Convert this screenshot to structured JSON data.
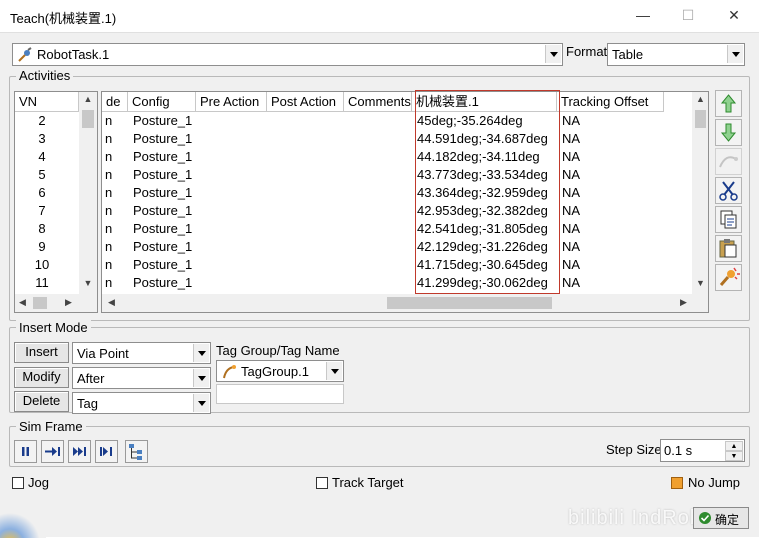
{
  "window": {
    "title": "Teach(机械装置.1)",
    "minimize_glyph": "—",
    "maximize_glyph": "☐",
    "close_glyph": "✕"
  },
  "task_combo": {
    "value": "RobotTask.1",
    "icon": "robot-task-icon"
  },
  "format": {
    "label": "Format",
    "value": "Table"
  },
  "activities": {
    "legend": "Activities",
    "vn_header": "VN",
    "vn_values": [
      "2",
      "3",
      "4",
      "5",
      "6",
      "7",
      "8",
      "9",
      "10",
      "11"
    ],
    "columns": [
      "de",
      "Config",
      "Pre Action",
      "Post Action",
      "Comments",
      "机械装置.1",
      "Tracking Offset"
    ],
    "rows": [
      {
        "de": "n",
        "config": "Posture_1",
        "pre": "",
        "post": "",
        "comments": "",
        "joint": "45deg;-35.264deg",
        "offset": "NA"
      },
      {
        "de": "n",
        "config": "Posture_1",
        "pre": "",
        "post": "",
        "comments": "",
        "joint": "44.591deg;-34.687deg",
        "offset": "NA"
      },
      {
        "de": "n",
        "config": "Posture_1",
        "pre": "",
        "post": "",
        "comments": "",
        "joint": "44.182deg;-34.11deg",
        "offset": "NA"
      },
      {
        "de": "n",
        "config": "Posture_1",
        "pre": "",
        "post": "",
        "comments": "",
        "joint": "43.773deg;-33.534deg",
        "offset": "NA"
      },
      {
        "de": "n",
        "config": "Posture_1",
        "pre": "",
        "post": "",
        "comments": "",
        "joint": "43.364deg;-32.959deg",
        "offset": "NA"
      },
      {
        "de": "n",
        "config": "Posture_1",
        "pre": "",
        "post": "",
        "comments": "",
        "joint": "42.953deg;-32.382deg",
        "offset": "NA"
      },
      {
        "de": "n",
        "config": "Posture_1",
        "pre": "",
        "post": "",
        "comments": "",
        "joint": "42.541deg;-31.805deg",
        "offset": "NA"
      },
      {
        "de": "n",
        "config": "Posture_1",
        "pre": "",
        "post": "",
        "comments": "",
        "joint": "42.129deg;-31.226deg",
        "offset": "NA"
      },
      {
        "de": "n",
        "config": "Posture_1",
        "pre": "",
        "post": "",
        "comments": "",
        "joint": "41.715deg;-30.645deg",
        "offset": "NA"
      },
      {
        "de": "n",
        "config": "Posture_1",
        "pre": "",
        "post": "",
        "comments": "",
        "joint": "41.299deg;-30.062deg",
        "offset": "NA"
      }
    ],
    "highlight_color": "#c0392b"
  },
  "insert_mode": {
    "legend": "Insert Mode",
    "buttons": [
      "Insert",
      "Modify",
      "Delete"
    ],
    "combos": [
      "Via Point",
      "After",
      "Tag"
    ],
    "tag_group_label": "Tag Group/Tag Name",
    "tag_group_value": "TagGroup.1"
  },
  "sim_frame": {
    "legend": "Sim Frame",
    "step_size_label": "Step Size",
    "step_size_value": "0.1 s"
  },
  "bottom": {
    "jog_label": "Jog",
    "track_target_label": "Track Target",
    "no_jump_label": "No Jump",
    "ok_label": "确定",
    "watermark": "bilibili IndRob"
  },
  "colors": {
    "accent_orange": "#f0a030",
    "arrow_green": "#2e8b2e"
  }
}
